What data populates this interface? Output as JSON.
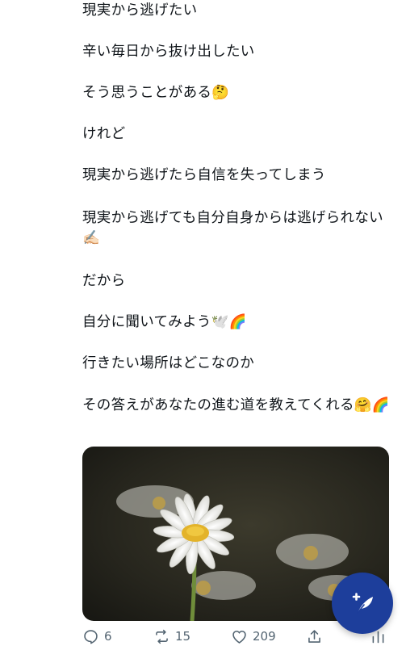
{
  "post": {
    "lines": [
      "現実から逃げたい",
      "辛い毎日から抜け出したい",
      "そう思うことがある🤔",
      "けれど",
      "現実から逃げたら自信を失ってしまう",
      "現実から逃げても自分自身からは逃げられない✍🏻",
      "だから",
      "自分に聞いてみよう🕊️🌈",
      "行きたい場所はどこなのか",
      "その答えがあなたの進む道を教えてくれる🤗🌈"
    ]
  },
  "actions": {
    "reply_count": "6",
    "repost_count": "15",
    "like_count": "209"
  },
  "icons": {
    "reply": "reply-icon",
    "repost": "repost-icon",
    "like": "heart-icon",
    "share": "share-icon",
    "stats": "stats-icon",
    "compose": "compose-feather-icon"
  },
  "colors": {
    "fab": "#1d3e9b",
    "action_gray": "#536471"
  }
}
